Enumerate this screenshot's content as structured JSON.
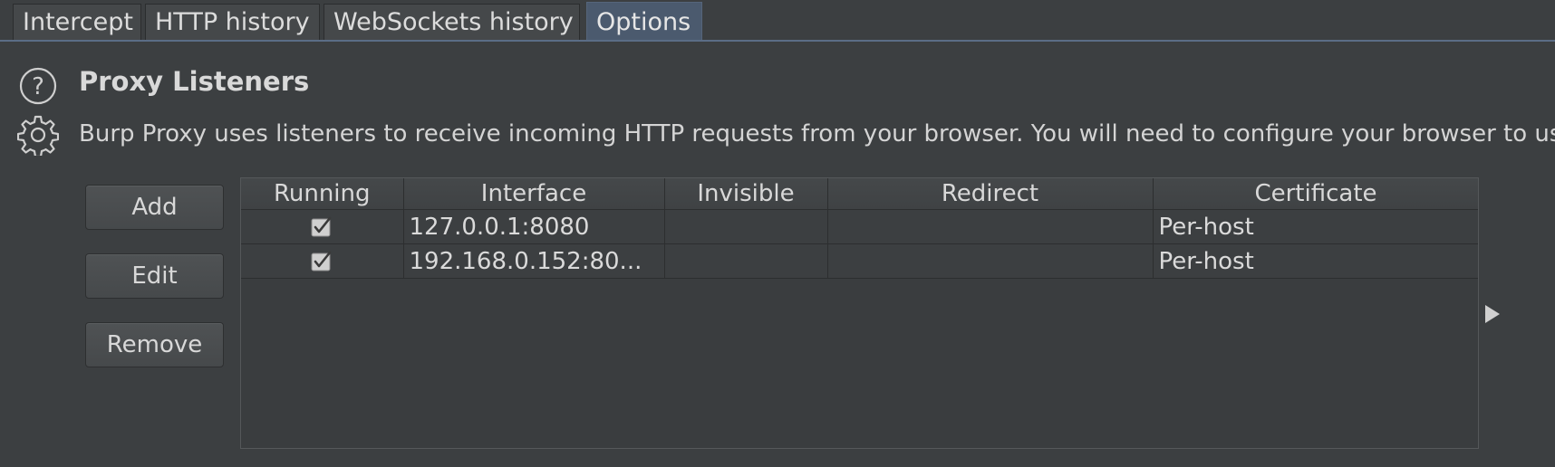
{
  "tabs": [
    {
      "label": "Intercept"
    },
    {
      "label": "HTTP history"
    },
    {
      "label": "WebSockets history"
    },
    {
      "label": "Options"
    }
  ],
  "section": {
    "title": "Proxy Listeners",
    "description": "Burp Proxy uses listeners to receive incoming HTTP requests from your browser. You will need to configure your browser to use one of the listeners as its proxy server."
  },
  "buttons": {
    "add": "Add",
    "edit": "Edit",
    "remove": "Remove"
  },
  "table": {
    "columns": [
      "Running",
      "Interface",
      "Invisible",
      "Redirect",
      "Certificate"
    ],
    "rows": [
      {
        "running": true,
        "interface": "127.0.0.1:8080",
        "invisible": "",
        "redirect": "",
        "certificate": "Per-host"
      },
      {
        "running": true,
        "interface": "192.168.0.152:80...",
        "invisible": "",
        "redirect": "",
        "certificate": "Per-host"
      }
    ]
  },
  "colors": {
    "background": "#3c3f41",
    "active_tab": "#4b5a6e",
    "accent_line": "#5b6d86"
  }
}
